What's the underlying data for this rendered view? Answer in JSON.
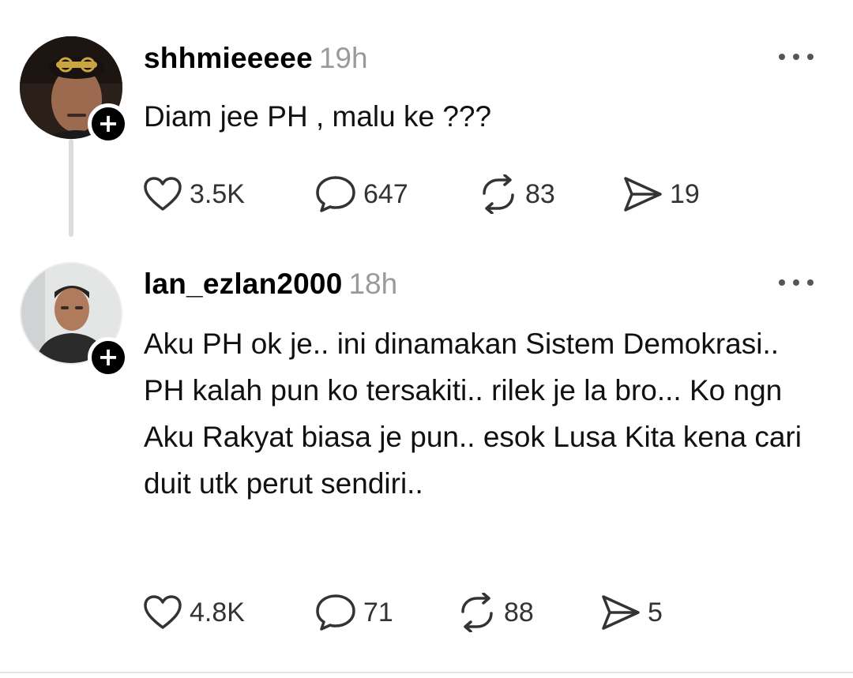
{
  "posts": [
    {
      "username": "shhmieeeee",
      "time": "19h",
      "text": "Diam jee PH , malu ke ???",
      "stats": {
        "likes": "3.5K",
        "replies": "647",
        "reposts": "83",
        "shares": "19"
      },
      "follow_symbol": "+"
    },
    {
      "username": "lan_ezlan2000",
      "time": "18h",
      "text": "Aku PH ok je.. ini dinamakan Sistem Demokrasi.. PH kalah pun ko tersakiti.. rilek je la bro... Ko ngn Aku Rakyat biasa je pun.. esok Lusa Kita kena cari duit utk perut sendiri..",
      "stats": {
        "likes": "4.8K",
        "replies": "71",
        "reposts": "88",
        "shares": "5"
      },
      "follow_symbol": "+"
    }
  ],
  "icons": {
    "like": "heart-outline",
    "reply": "speech-bubble",
    "repost": "repost-arrows",
    "share": "paper-plane",
    "more": "three-dots",
    "follow": "plus"
  },
  "colors": {
    "text": "#000000",
    "muted": "#9a9a9a",
    "icon": "#333333",
    "thread_line": "#dcdcdc"
  }
}
